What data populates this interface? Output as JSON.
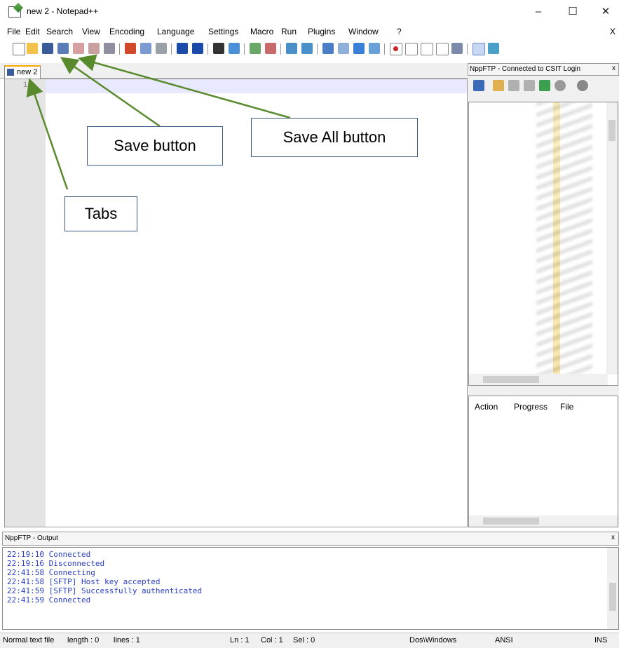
{
  "window": {
    "title": "new 2 - Notepad++",
    "minimize": "–",
    "maximize": "☐",
    "close": "✕",
    "doc_close": "X"
  },
  "menu": [
    "File",
    "Edit",
    "Search",
    "View",
    "Encoding",
    "Language",
    "Settings",
    "Macro",
    "Run",
    "Plugins",
    "Window",
    "?"
  ],
  "tabs": [
    {
      "label": "new 2"
    }
  ],
  "editor": {
    "first_line_number": "1"
  },
  "ftp_panel": {
    "title": "NppFTP - Connected to CSIT Login",
    "close": "x",
    "queue_headers": [
      "Action",
      "Progress",
      "File"
    ]
  },
  "output_panel": {
    "title": "NppFTP - Output",
    "close": "x",
    "log": [
      {
        "time": "22:19:10",
        "msg": "Connected"
      },
      {
        "time": "22:19:16",
        "msg": "Disconnected"
      },
      {
        "time": "22:41:58",
        "msg": "Connecting"
      },
      {
        "time": "22:41:58",
        "msg": "[SFTP] Host key accepted"
      },
      {
        "time": "22:41:59",
        "msg": "[SFTP] Successfully authenticated"
      },
      {
        "time": "22:41:59",
        "msg": "Connected"
      }
    ]
  },
  "statusbar": {
    "file_type": "Normal text file",
    "length": "length : 0",
    "lines": "lines : 1",
    "ln": "Ln : 1",
    "col": "Col : 1",
    "sel": "Sel : 0",
    "eol": "Dos\\Windows",
    "encoding": "ANSI",
    "mode": "INS"
  },
  "annotations": {
    "save_button": "Save button",
    "save_all_button": "Save All button",
    "tabs": "Tabs"
  },
  "colors": {
    "annotation_arrow": "#5a8a2e",
    "log_text": "#2a3fc4",
    "tab_accent": "#f7a700",
    "caret_line": "#e8e8ff"
  }
}
